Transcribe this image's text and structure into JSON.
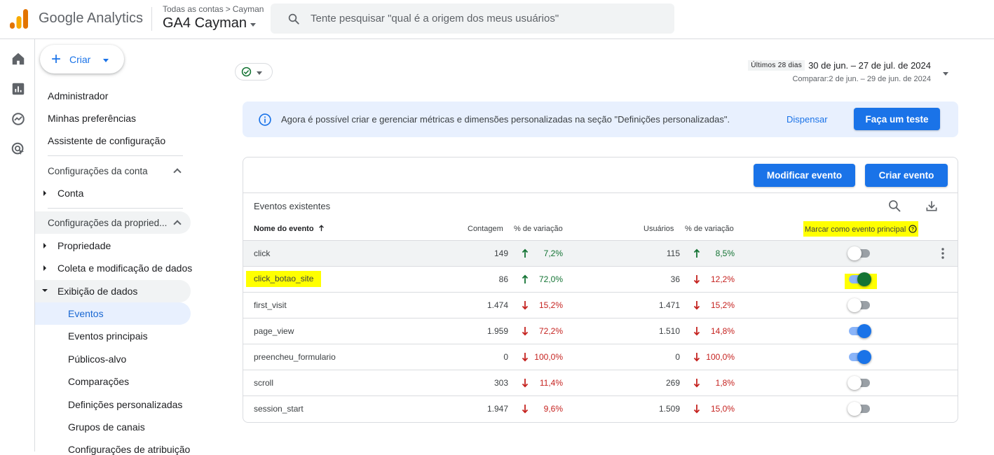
{
  "header": {
    "brand": "Google Analytics",
    "breadcrumb_all": "Todas as contas",
    "breadcrumb_sep": ">",
    "breadcrumb_account": "Cayman",
    "property": "GA4 Cayman",
    "search_placeholder": "Tente pesquisar \"qual é a origem dos meus usuários\""
  },
  "nav": {
    "create_label": "Criar",
    "items": [
      "Administrador",
      "Minhas preferências",
      "Assistente de configuração"
    ],
    "account_section": "Configurações da conta",
    "account_item": "Conta",
    "property_section": "Configurações da propried...",
    "property_items": [
      "Propriedade",
      "Coleta e modificação de dados",
      "Exibição de dados"
    ],
    "data_display_items": [
      "Eventos",
      "Eventos principais",
      "Públicos-alvo",
      "Comparações",
      "Definições personalizadas",
      "Grupos de canais",
      "Configurações de atribuição"
    ]
  },
  "date": {
    "tag": "Últimos 28 dias",
    "range": "30 de jun. – 27 de jul. de 2024",
    "compare": "Comparar:2 de jun. – 29 de jun. de 2024"
  },
  "banner": {
    "text": "Agora é possível criar e gerenciar métricas e dimensões personalizadas na seção \"Definições personalizadas\".",
    "dismiss": "Dispensar",
    "try": "Faça um teste"
  },
  "card": {
    "modify_button": "Modificar evento",
    "create_button": "Criar evento",
    "title": "Eventos existentes",
    "columns": {
      "name": "Nome do evento",
      "count": "Contagem",
      "count_change": "% de variação",
      "users": "Usuários",
      "users_change": "% de variação",
      "key_event": "Marcar como evento principal"
    },
    "rows": [
      {
        "name": "click",
        "count": "149",
        "count_dir": "up",
        "count_pct": "7,2%",
        "users": "115",
        "users_dir": "up",
        "users_pct": "8,5%",
        "key": "off"
      },
      {
        "name": "click_botao_site",
        "count": "86",
        "count_dir": "up",
        "count_pct": "72,0%",
        "users": "36",
        "users_dir": "down",
        "users_pct": "12,2%",
        "key": "on"
      },
      {
        "name": "first_visit",
        "count": "1.474",
        "count_dir": "down",
        "count_pct": "15,2%",
        "users": "1.471",
        "users_dir": "down",
        "users_pct": "15,2%",
        "key": "off"
      },
      {
        "name": "page_view",
        "count": "1.959",
        "count_dir": "down",
        "count_pct": "72,2%",
        "users": "1.510",
        "users_dir": "down",
        "users_pct": "14,8%",
        "key": "on"
      },
      {
        "name": "preencheu_formulario",
        "count": "0",
        "count_dir": "down",
        "count_pct": "100,0%",
        "users": "0",
        "users_dir": "down",
        "users_pct": "100,0%",
        "key": "on"
      },
      {
        "name": "scroll",
        "count": "303",
        "count_dir": "down",
        "count_pct": "11,4%",
        "users": "269",
        "users_dir": "down",
        "users_pct": "1,8%",
        "key": "off"
      },
      {
        "name": "session_start",
        "count": "1.947",
        "count_dir": "down",
        "count_pct": "9,6%",
        "users": "1.509",
        "users_dir": "down",
        "users_pct": "15,0%",
        "key": "off"
      }
    ]
  },
  "colors": {
    "accent": "#1a73e8",
    "up": "#137333",
    "down": "#c5221f",
    "highlight": "#ffff00"
  }
}
